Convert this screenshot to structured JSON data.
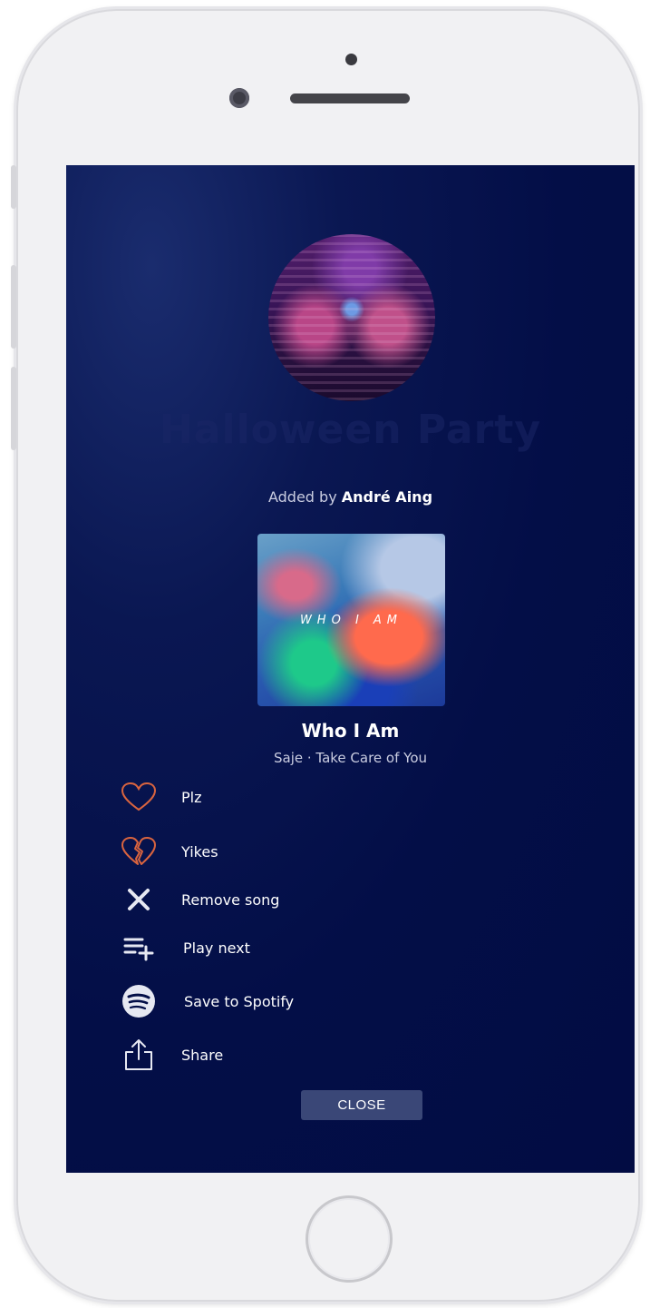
{
  "playlist": {
    "title": "Halloween Party",
    "added_by_prefix": "Added by",
    "added_by_user": "André Aing"
  },
  "album": {
    "cover_text": "WHO I AM"
  },
  "song": {
    "title": "Who I Am",
    "subtitle": "Saje · Take Care of You"
  },
  "actions": [
    {
      "label": "Plz",
      "icon": "heart-outline-icon"
    },
    {
      "label": "Yikes",
      "icon": "broken-heart-icon"
    },
    {
      "label": "Remove song",
      "icon": "close-x-icon"
    },
    {
      "label": "Play next",
      "icon": "queue-add-icon"
    },
    {
      "label": "Save to Spotify",
      "icon": "spotify-icon"
    },
    {
      "label": "Share",
      "icon": "share-icon"
    }
  ],
  "close_label": "CLOSE",
  "colors": {
    "screen_bg": "#030e47",
    "accent_heart": "#d9643f",
    "close_bg": "#3a4777"
  }
}
